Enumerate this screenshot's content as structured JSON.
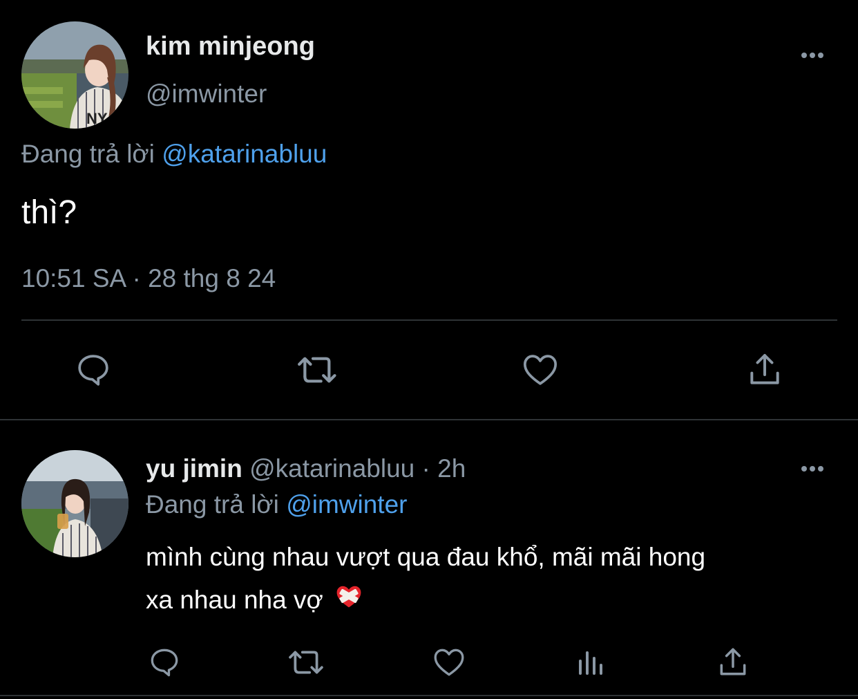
{
  "main_tweet": {
    "display_name": "kim minjeong",
    "handle": "@imwinter",
    "replying_prefix": "Đang trả lời",
    "replying_to": "@katarinabluu",
    "text": "thì?",
    "timestamp": "10:51 SA · 28 thg 8 24",
    "avatar_icon": "profile-photo-icon"
  },
  "actions_main": [
    "reply-icon",
    "retweet-icon",
    "like-icon",
    "share-icon"
  ],
  "reply": {
    "display_name": "yu jimin",
    "handle": "@katarinabluu",
    "separator_time": "· 2h",
    "replying_prefix": "Đang trả lời",
    "replying_to": "@imwinter",
    "text_line1": "mình cùng nhau vượt qua đau khổ, mãi mãi hong",
    "text_line2": "xa nhau nha vợ",
    "emoji": "❤️‍🩹"
  },
  "actions_reply": [
    "reply-icon",
    "retweet-icon",
    "like-icon",
    "views-icon",
    "share-icon"
  ],
  "colors": {
    "background": "#000000",
    "text_primary": "#e7e9ea",
    "text_muted": "#8b98a5",
    "link": "#4fa1ec",
    "divider": "#2f3336"
  }
}
